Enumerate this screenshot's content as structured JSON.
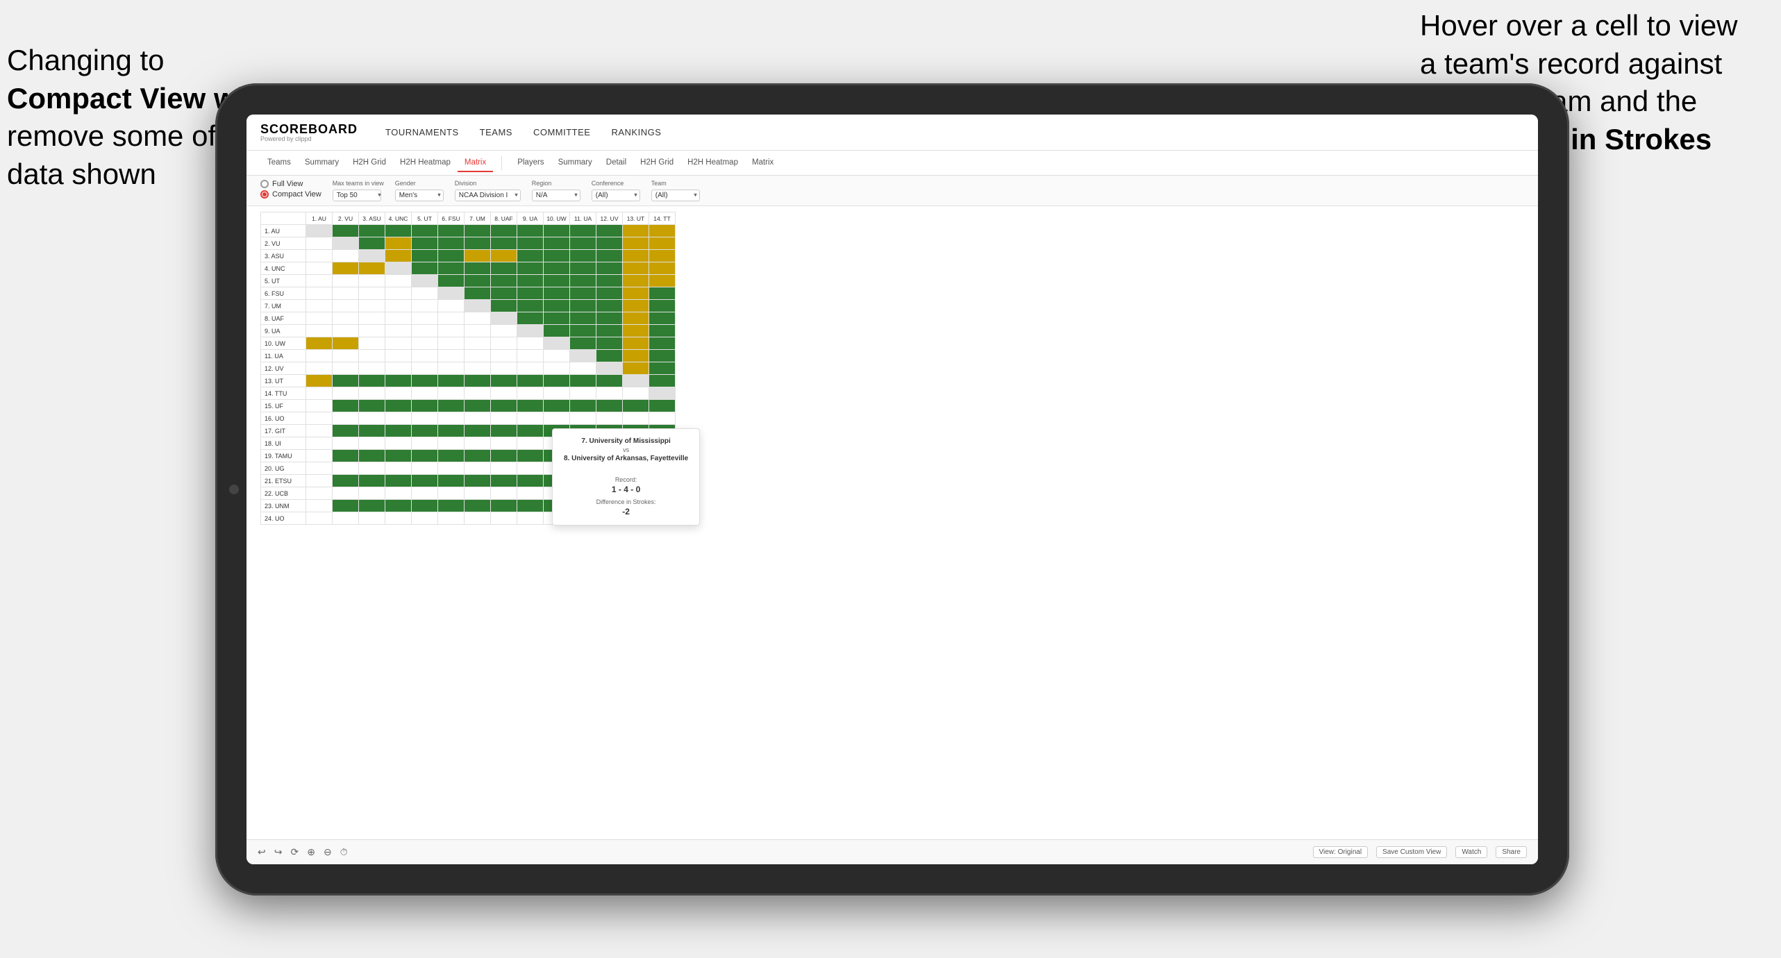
{
  "annotations": {
    "left_title": "Changing to",
    "left_bold": "Compact View will",
    "left_rest": "remove some of the initial data shown",
    "right_text": "Hover over a cell to view a team's record against another team and the",
    "right_bold": "Difference in Strokes"
  },
  "header": {
    "logo": "SCOREBOARD",
    "logo_sub": "Powered by clippd",
    "nav": [
      "TOURNAMENTS",
      "TEAMS",
      "COMMITTEE",
      "RANKINGS"
    ]
  },
  "sub_nav": {
    "group1": [
      "Teams",
      "Summary",
      "H2H Grid",
      "H2H Heatmap",
      "Matrix"
    ],
    "group2": [
      "Players",
      "Summary",
      "Detail",
      "H2H Grid",
      "H2H Heatmap",
      "Matrix"
    ],
    "active": "Matrix"
  },
  "controls": {
    "view_options": [
      "Full View",
      "Compact View"
    ],
    "selected_view": "Compact View",
    "filters": {
      "max_teams": {
        "label": "Max teams in view",
        "value": "Top 50"
      },
      "gender": {
        "label": "Gender",
        "value": "Men's"
      },
      "division": {
        "label": "Division",
        "value": "NCAA Division I"
      },
      "region": {
        "label": "Region",
        "value": "N/A"
      },
      "conference": {
        "label": "Conference",
        "value": "(All)"
      },
      "team": {
        "label": "Team",
        "value": "(All)"
      }
    }
  },
  "matrix": {
    "col_headers": [
      "1. AU",
      "2. VU",
      "3. ASU",
      "4. UNC",
      "5. UT",
      "6. FSU",
      "7. UM",
      "8. UAF",
      "9. UA",
      "10. UW",
      "11. UA",
      "12. UV",
      "13. UT",
      "14. TT"
    ],
    "rows": [
      {
        "label": "1. AU",
        "cells": [
          "diag",
          "g",
          "g",
          "g",
          "g",
          "g",
          "g",
          "g",
          "g",
          "g",
          "g",
          "g",
          "y",
          "y"
        ]
      },
      {
        "label": "2. VU",
        "cells": [
          "w",
          "diag",
          "g",
          "y",
          "g",
          "g",
          "g",
          "g",
          "g",
          "g",
          "g",
          "g",
          "y",
          "y"
        ]
      },
      {
        "label": "3. ASU",
        "cells": [
          "w",
          "w",
          "diag",
          "y",
          "g",
          "g",
          "y",
          "y",
          "g",
          "g",
          "g",
          "g",
          "y",
          "y"
        ]
      },
      {
        "label": "4. UNC",
        "cells": [
          "w",
          "y",
          "y",
          "diag",
          "g",
          "g",
          "g",
          "g",
          "g",
          "g",
          "g",
          "g",
          "y",
          "y"
        ]
      },
      {
        "label": "5. UT",
        "cells": [
          "w",
          "w",
          "w",
          "w",
          "diag",
          "g",
          "g",
          "g",
          "g",
          "g",
          "g",
          "g",
          "y",
          "y"
        ]
      },
      {
        "label": "6. FSU",
        "cells": [
          "w",
          "w",
          "w",
          "w",
          "w",
          "diag",
          "g",
          "g",
          "g",
          "g",
          "g",
          "g",
          "y",
          "g"
        ]
      },
      {
        "label": "7. UM",
        "cells": [
          "w",
          "w",
          "w",
          "w",
          "w",
          "w",
          "diag",
          "g",
          "g",
          "g",
          "g",
          "g",
          "y",
          "g"
        ]
      },
      {
        "label": "8. UAF",
        "cells": [
          "w",
          "w",
          "w",
          "w",
          "w",
          "w",
          "w",
          "diag",
          "g",
          "g",
          "g",
          "g",
          "y",
          "g"
        ]
      },
      {
        "label": "9. UA",
        "cells": [
          "w",
          "w",
          "w",
          "w",
          "w",
          "w",
          "w",
          "w",
          "diag",
          "g",
          "g",
          "g",
          "y",
          "g"
        ]
      },
      {
        "label": "10. UW",
        "cells": [
          "y",
          "y",
          "w",
          "w",
          "w",
          "w",
          "w",
          "w",
          "w",
          "diag",
          "g",
          "g",
          "y",
          "g"
        ]
      },
      {
        "label": "11. UA",
        "cells": [
          "w",
          "w",
          "w",
          "w",
          "w",
          "w",
          "w",
          "w",
          "w",
          "w",
          "diag",
          "g",
          "y",
          "g"
        ]
      },
      {
        "label": "12. UV",
        "cells": [
          "w",
          "w",
          "w",
          "w",
          "w",
          "w",
          "w",
          "w",
          "w",
          "w",
          "w",
          "diag",
          "y",
          "g"
        ]
      },
      {
        "label": "13. UT",
        "cells": [
          "y",
          "g",
          "g",
          "g",
          "g",
          "g",
          "g",
          "g",
          "g",
          "g",
          "g",
          "g",
          "diag",
          "g"
        ]
      },
      {
        "label": "14. TTU",
        "cells": [
          "w",
          "w",
          "w",
          "w",
          "w",
          "w",
          "w",
          "w",
          "w",
          "w",
          "w",
          "w",
          "w",
          "diag"
        ]
      },
      {
        "label": "15. UF",
        "cells": [
          "w",
          "g",
          "g",
          "g",
          "g",
          "g",
          "g",
          "g",
          "g",
          "g",
          "g",
          "g",
          "g",
          "g"
        ]
      },
      {
        "label": "16. UO",
        "cells": [
          "w",
          "w",
          "w",
          "w",
          "w",
          "w",
          "w",
          "w",
          "w",
          "w",
          "w",
          "w",
          "w",
          "w"
        ]
      },
      {
        "label": "17. GIT",
        "cells": [
          "w",
          "g",
          "g",
          "g",
          "g",
          "g",
          "g",
          "g",
          "g",
          "g",
          "g",
          "g",
          "g",
          "g"
        ]
      },
      {
        "label": "18. UI",
        "cells": [
          "w",
          "w",
          "w",
          "w",
          "w",
          "w",
          "w",
          "w",
          "w",
          "w",
          "w",
          "w",
          "w",
          "w"
        ]
      },
      {
        "label": "19. TAMU",
        "cells": [
          "w",
          "g",
          "g",
          "g",
          "g",
          "g",
          "g",
          "g",
          "g",
          "g",
          "g",
          "g",
          "g",
          "g"
        ]
      },
      {
        "label": "20. UG",
        "cells": [
          "w",
          "w",
          "w",
          "w",
          "w",
          "w",
          "w",
          "w",
          "w",
          "w",
          "w",
          "w",
          "w",
          "w"
        ]
      },
      {
        "label": "21. ETSU",
        "cells": [
          "w",
          "g",
          "g",
          "g",
          "g",
          "g",
          "g",
          "g",
          "g",
          "g",
          "g",
          "g",
          "g",
          "g"
        ]
      },
      {
        "label": "22. UCB",
        "cells": [
          "w",
          "w",
          "w",
          "w",
          "w",
          "w",
          "w",
          "w",
          "w",
          "w",
          "w",
          "w",
          "w",
          "w"
        ]
      },
      {
        "label": "23. UNM",
        "cells": [
          "w",
          "g",
          "g",
          "g",
          "g",
          "g",
          "g",
          "g",
          "g",
          "g",
          "g",
          "g",
          "g",
          "g"
        ]
      },
      {
        "label": "24. UO",
        "cells": [
          "w",
          "w",
          "w",
          "w",
          "w",
          "w",
          "w",
          "w",
          "w",
          "w",
          "w",
          "w",
          "w",
          "w"
        ]
      }
    ]
  },
  "tooltip": {
    "team1": "7. University of Mississippi",
    "vs": "vs",
    "team2": "8. University of Arkansas, Fayetteville",
    "record_label": "Record:",
    "record_value": "1 - 4 - 0",
    "strokes_label": "Difference in Strokes:",
    "strokes_value": "-2"
  },
  "toolbar": {
    "buttons": [
      "View: Original",
      "Save Custom View",
      "Watch",
      "Share"
    ]
  }
}
